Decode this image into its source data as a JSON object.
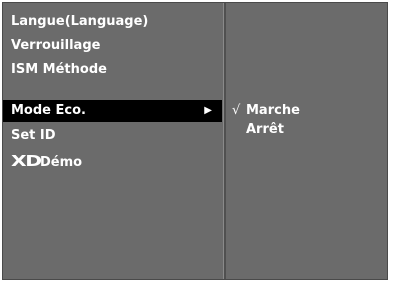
{
  "menu": {
    "items": [
      {
        "label": "Langue(Language)"
      },
      {
        "label": "Verrouillage"
      },
      {
        "label": "ISM Méthode"
      },
      {
        "label": "Mode Eco.",
        "arrow": "▶"
      },
      {
        "label": "Set ID"
      },
      {
        "label": "Démo",
        "logo": "XD"
      }
    ],
    "selected_index": 3
  },
  "submenu": {
    "check_mark": "√",
    "options": [
      {
        "label": "Marche"
      },
      {
        "label": "Arrêt"
      }
    ],
    "checked_index": 0
  },
  "colors": {
    "panel": "#6b6b6b",
    "highlight": "#000000",
    "text": "#ffffff"
  }
}
